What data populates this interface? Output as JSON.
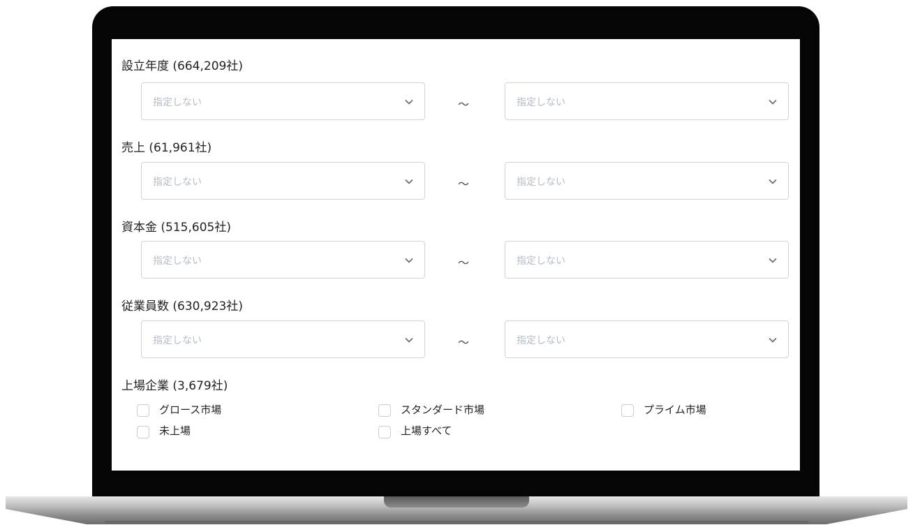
{
  "filters": [
    {
      "label": "設立年度 (664,209社)",
      "from_placeholder": "指定しない",
      "to_placeholder": "指定しない",
      "separator": "～"
    },
    {
      "label": "売上 (61,961社)",
      "from_placeholder": "指定しない",
      "to_placeholder": "指定しない",
      "separator": "～"
    },
    {
      "label": "資本金 (515,605社)",
      "from_placeholder": "指定しない",
      "to_placeholder": "指定しない",
      "separator": "～"
    },
    {
      "label": "従業員数 (630,923社)",
      "from_placeholder": "指定しない",
      "to_placeholder": "指定しない",
      "separator": "～"
    }
  ],
  "listed": {
    "label": "上場企業 (3,679社)",
    "options": [
      {
        "label": "グロース市場",
        "checked": false
      },
      {
        "label": "スタンダード市場",
        "checked": false
      },
      {
        "label": "プライム市場",
        "checked": false
      },
      {
        "label": "未上場",
        "checked": false
      },
      {
        "label": "上場すべて",
        "checked": false
      }
    ]
  },
  "icons": {
    "dropdown": "chevron-down-icon"
  },
  "colors": {
    "placeholder": "#b3bcc7",
    "border": "#cfd3d8",
    "bezel": "#050505"
  }
}
